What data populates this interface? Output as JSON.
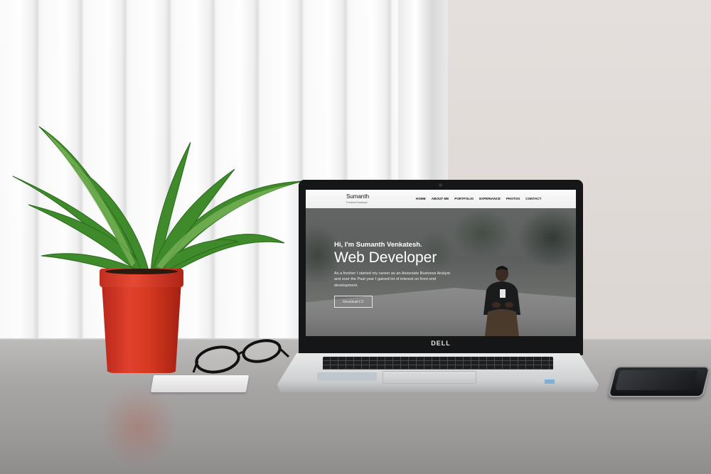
{
  "laptop": {
    "brand": "DELL"
  },
  "site": {
    "brand_name": "Sumanth",
    "brand_tagline": "Frontend Developer",
    "nav": [
      {
        "label": "HOME"
      },
      {
        "label": "ABOUT ME"
      },
      {
        "label": "PORTFOLIO"
      },
      {
        "label": "EXPERIANCE"
      },
      {
        "label": "PHOTOS"
      },
      {
        "label": "CONTACT"
      }
    ],
    "hero": {
      "greeting": "Hi, I'm Sumanth Venkatesh.",
      "title": "Web Developer",
      "text": "As a fresher I started my career as an Associate Business Analyst and over the Past year I gained lot of interest on front-end development.",
      "button_label": "Download CV"
    }
  },
  "colors": {
    "pot": "#d5391f",
    "leaf": "#3f8a2b",
    "laptop_body": "#151617",
    "wall": "#e4dfdc",
    "desk": "#a7a5a4"
  }
}
